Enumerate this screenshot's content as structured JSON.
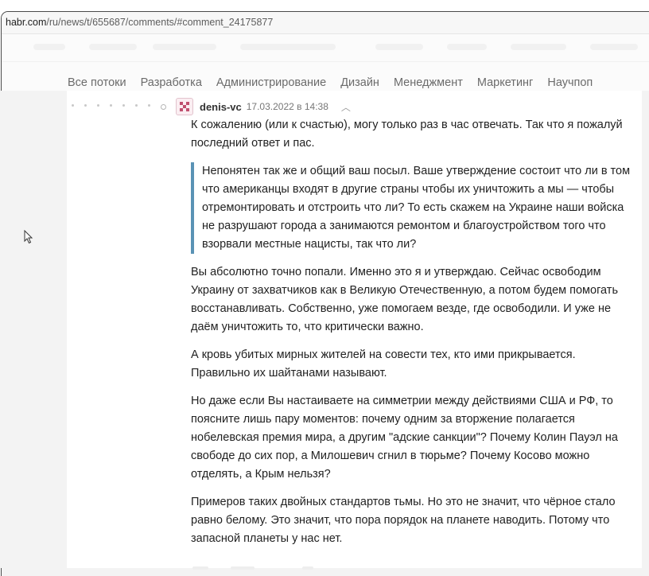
{
  "browser": {
    "url_host": "habr.com",
    "url_path": "/ru/news/t/655687/comments/#comment_24175877"
  },
  "hubs": [
    "Все потоки",
    "Разработка",
    "Администрирование",
    "Дизайн",
    "Менеджмент",
    "Маркетинг",
    "Научпоп"
  ],
  "comment": {
    "author": "denis-vc",
    "date": "17.03.2022 в 14:38",
    "paragraphs": {
      "intro": "К сожалению (или к счастью), могу только раз в час отвечать. Так что я пожалуй последний ответ и пас.",
      "quote": "Непонятен так же и общий ваш посыл. Ваше утверждение состоит что ли в том что американцы входят в другие страны чтобы их уничтожить а мы — чтобы отремонтировать и отстроить что ли? То есть скажем на Украине наши войска не разрушают города а занимаются ремонтом и благоустройством того что взорвали местные нацисты, так что ли?",
      "p1": "Вы абсолютно точно попали. Именно это я и утверждаю. Сейчас освободим Украину от захватчиков как в Великую Отечественную, а потом будем помогать восстанавливать. Собственно, уже помогаем везде, где освободили. И уже не даём уничтожить то, что критически важно.",
      "p2": "А кровь убитых мирных жителей на совести тех, кто ими прикрывается. Правильно их шайтанами называют.",
      "p3": "Но даже если Вы настаиваете на симметрии между действиями США и РФ, то поясните лишь пару моментов: почему одним за вторжение полагается нобелевская премия мира, а другим \"адские санкции\"? Почему Колин Пауэл на свободе до сих пор, а Милошевич сгнил в тюрьме? Почему Косово можно отделять, а Крым нельзя?",
      "p4": "Примеров таких двойных стандартов тьмы. Но это не значит, что чёрное стало равно белому. Это значит, что пора порядок на планете наводить. Потому что запасной планеты у нас нет."
    }
  },
  "colors": {
    "quote_border": "#5a93b5",
    "avatar_accent": "#c0506f"
  }
}
